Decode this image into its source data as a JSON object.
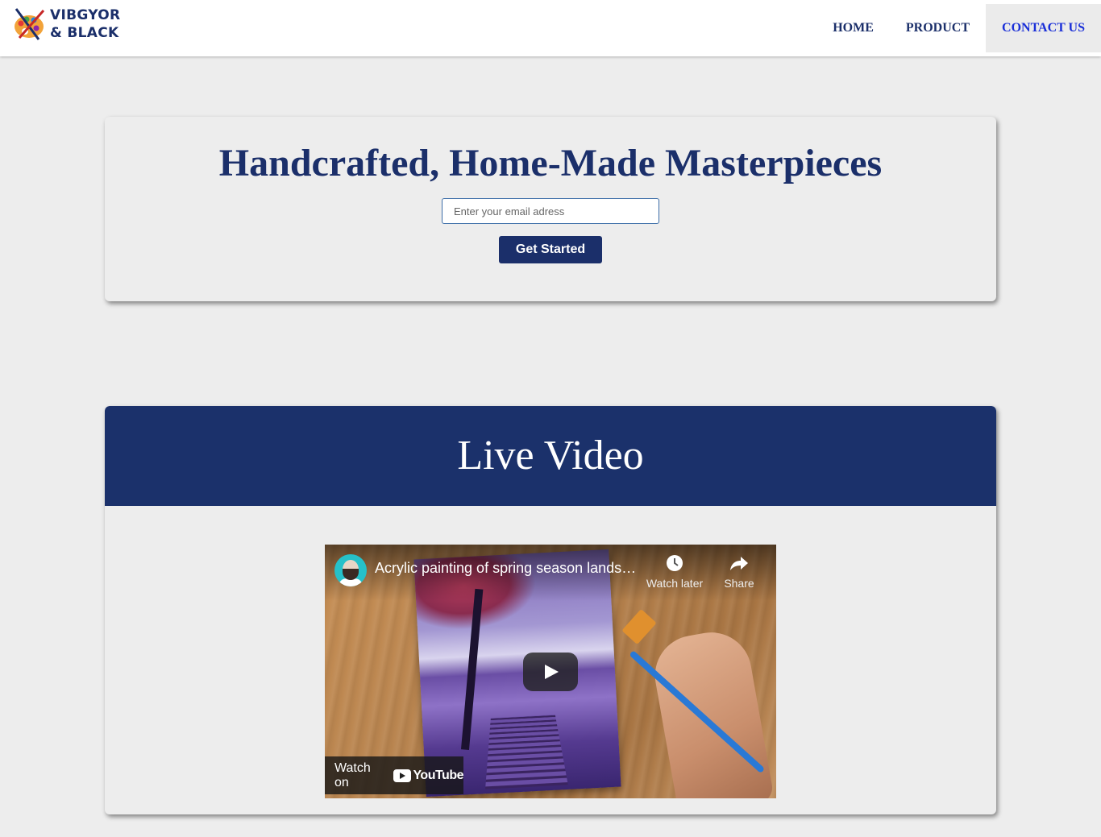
{
  "brand": {
    "line1": "VIBGYOR",
    "line2": "& BLACK"
  },
  "nav": {
    "items": [
      {
        "label": "HOME"
      },
      {
        "label": "PRODUCT"
      },
      {
        "label": "CONTACT US"
      }
    ]
  },
  "hero": {
    "title": "Handcrafted, Home-Made Masterpieces",
    "email_placeholder": "Enter your email adress",
    "email_value": "",
    "cta_label": "Get Started"
  },
  "video_section": {
    "heading": "Live Video",
    "player": {
      "title": "Acrylic painting of spring season lands…",
      "watch_later_label": "Watch later",
      "share_label": "Share",
      "watch_on_label": "Watch on",
      "youtube_label": "YouTube"
    }
  },
  "colors": {
    "brand_navy": "#1b2f6a",
    "active_nav": "#1a2fd8",
    "page_bg": "#ededed"
  }
}
